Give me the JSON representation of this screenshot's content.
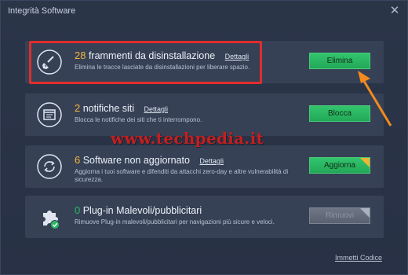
{
  "window": {
    "title": "Integrità Software",
    "close_glyph": "✕"
  },
  "cards": [
    {
      "count": "28",
      "headline": "frammenti da disinstallazione",
      "details": "Dettagli",
      "description": "Elimina le tracce lasciate da disinstallazioni per liberare spazio.",
      "button": "Elimina",
      "icon": "broom-icon"
    },
    {
      "count": "2",
      "headline": "notifiche siti",
      "details": "Dettagli",
      "description": "Blocca le notifiche dei siti che ti interrompono.",
      "button": "Blocca",
      "icon": "notification-icon"
    },
    {
      "count": "6",
      "headline": "Software non aggiornato",
      "details": "Dettagli",
      "description": "Aggiorna i tuoi software e difenditi da attacchi zero-day e altre vulnerabilità di sicurezza.",
      "button": "Aggiorna",
      "icon": "refresh-icon"
    },
    {
      "count": "0",
      "headline": "Plug-in Malevoli/pubblicitari",
      "details": "",
      "description": "Rimuove Plug-in malevoli/pubblicitari per navigazioni più sicure e veloci.",
      "button": "Rimuovi",
      "icon": "puzzle-icon"
    }
  ],
  "watermark": "www.techpedia.it",
  "footer": {
    "link": "Immetti Codice"
  },
  "colors": {
    "accent_green": "#2bb862",
    "count_orange": "#f3b53c",
    "highlight_red": "#e02d2d",
    "arrow_orange": "#f28a1e"
  }
}
